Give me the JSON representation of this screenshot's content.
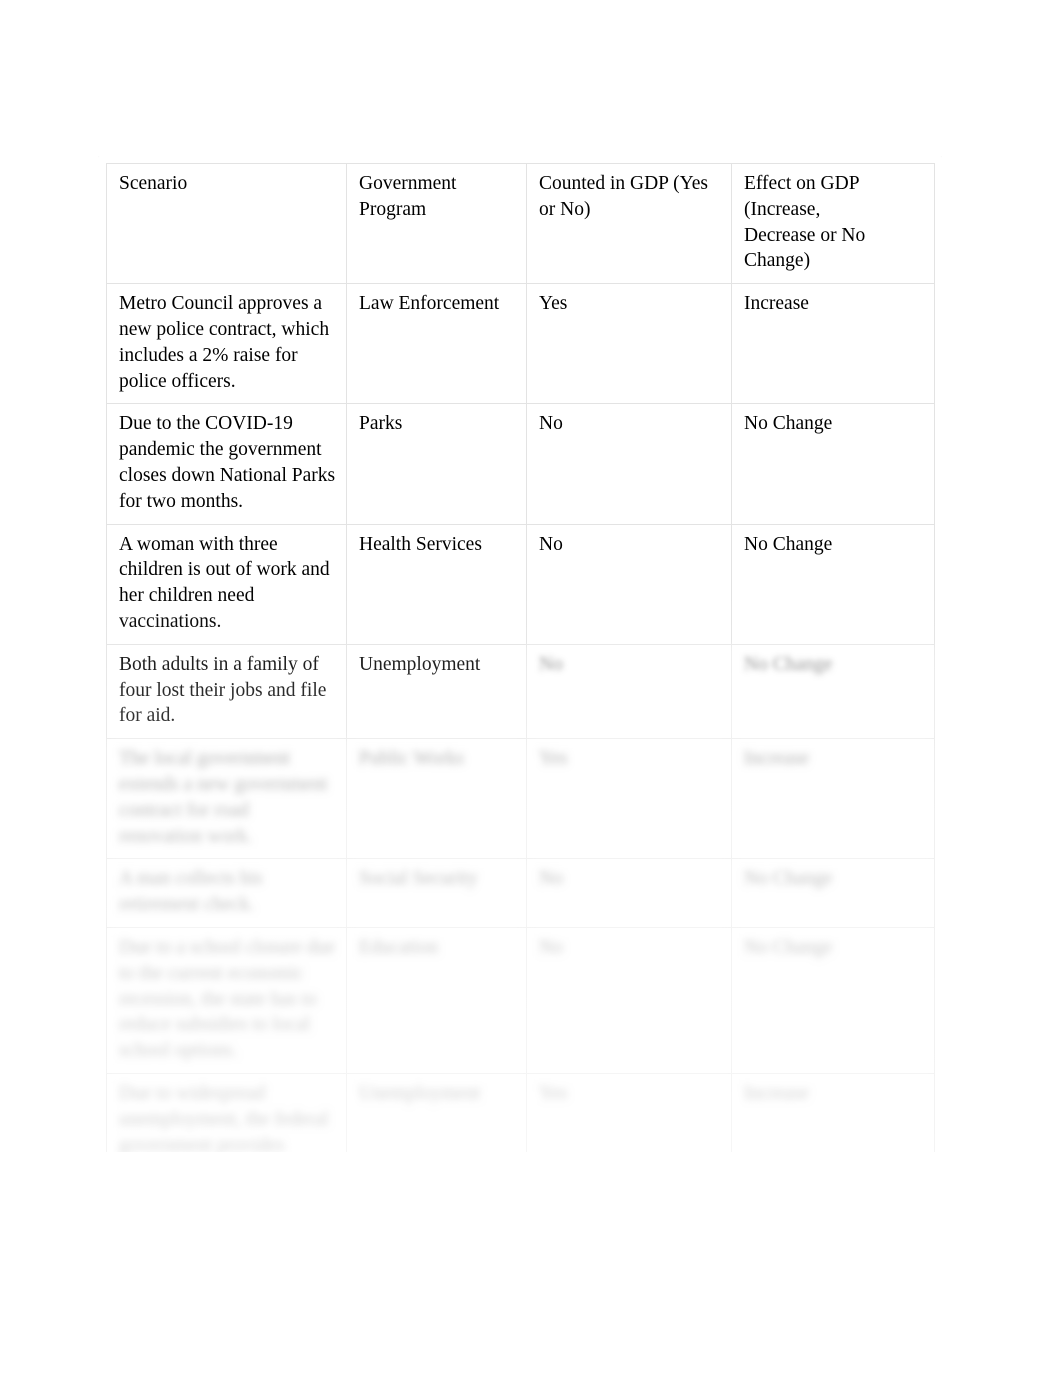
{
  "document": {
    "title": "Scenario / Government Program / GDP worksheet table",
    "page_background": "#ffffff",
    "text_color": "#000000",
    "grid_line_color": "#e3e3e3"
  },
  "table": {
    "columns": [
      "Scenario",
      "Government Program",
      "Counted in GDP (Yes or No)",
      "Effect on GDP (Increase, Decrease or No Change)"
    ],
    "header": {
      "scenario": "Scenario",
      "program": "Government\nProgram",
      "counted": "Counted in GDP (Yes\nor No)",
      "effect": "Effect on GDP\n(Increase,\nDecrease or No\nChange)"
    },
    "rows": [
      {
        "scenario": "Metro Council approves a new police contract, which includes a 2% raise for police officers.",
        "program": "Law Enforcement",
        "counted": "Yes",
        "effect": "Increase",
        "legibility": "clear"
      },
      {
        "scenario": "Due to the COVID-19 pandemic the government closes down National Parks for two months.",
        "program": "Parks",
        "counted": "No",
        "effect": "No Change",
        "legibility": "clear"
      },
      {
        "scenario": "A woman with three children is out of work and her children need vaccinations.",
        "program": "Health Services",
        "counted": "No",
        "effect": " No Change",
        "legibility": "clear"
      },
      {
        "scenario": "Both adults in a family of four lost their jobs and file for aid.",
        "program": "Unemployment",
        "counted": "No",
        "effect": "No Change",
        "legibility": "partially-faded"
      },
      {
        "scenario": "The local government extends a new government contract for road renovation work.",
        "program": "Public Works",
        "counted": "Yes",
        "effect": "Increase",
        "legibility": "faded"
      },
      {
        "scenario": "A man collects his retirement check.",
        "program": "Social Security",
        "counted": "No",
        "effect": "No Change",
        "legibility": "faded"
      },
      {
        "scenario": "Due to a school closure due to the current economic recession, the state has to reduce subsidies to local school options.",
        "program": "Education",
        "counted": "No",
        "effect": "No Change",
        "legibility": "faded"
      },
      {
        "scenario": "Due to widespread unemployment, the federal government provides additional funding for unemployment checks.",
        "program": "Unemployment",
        "counted": "Yes",
        "effect": "Increase",
        "legibility": "faded"
      }
    ]
  }
}
